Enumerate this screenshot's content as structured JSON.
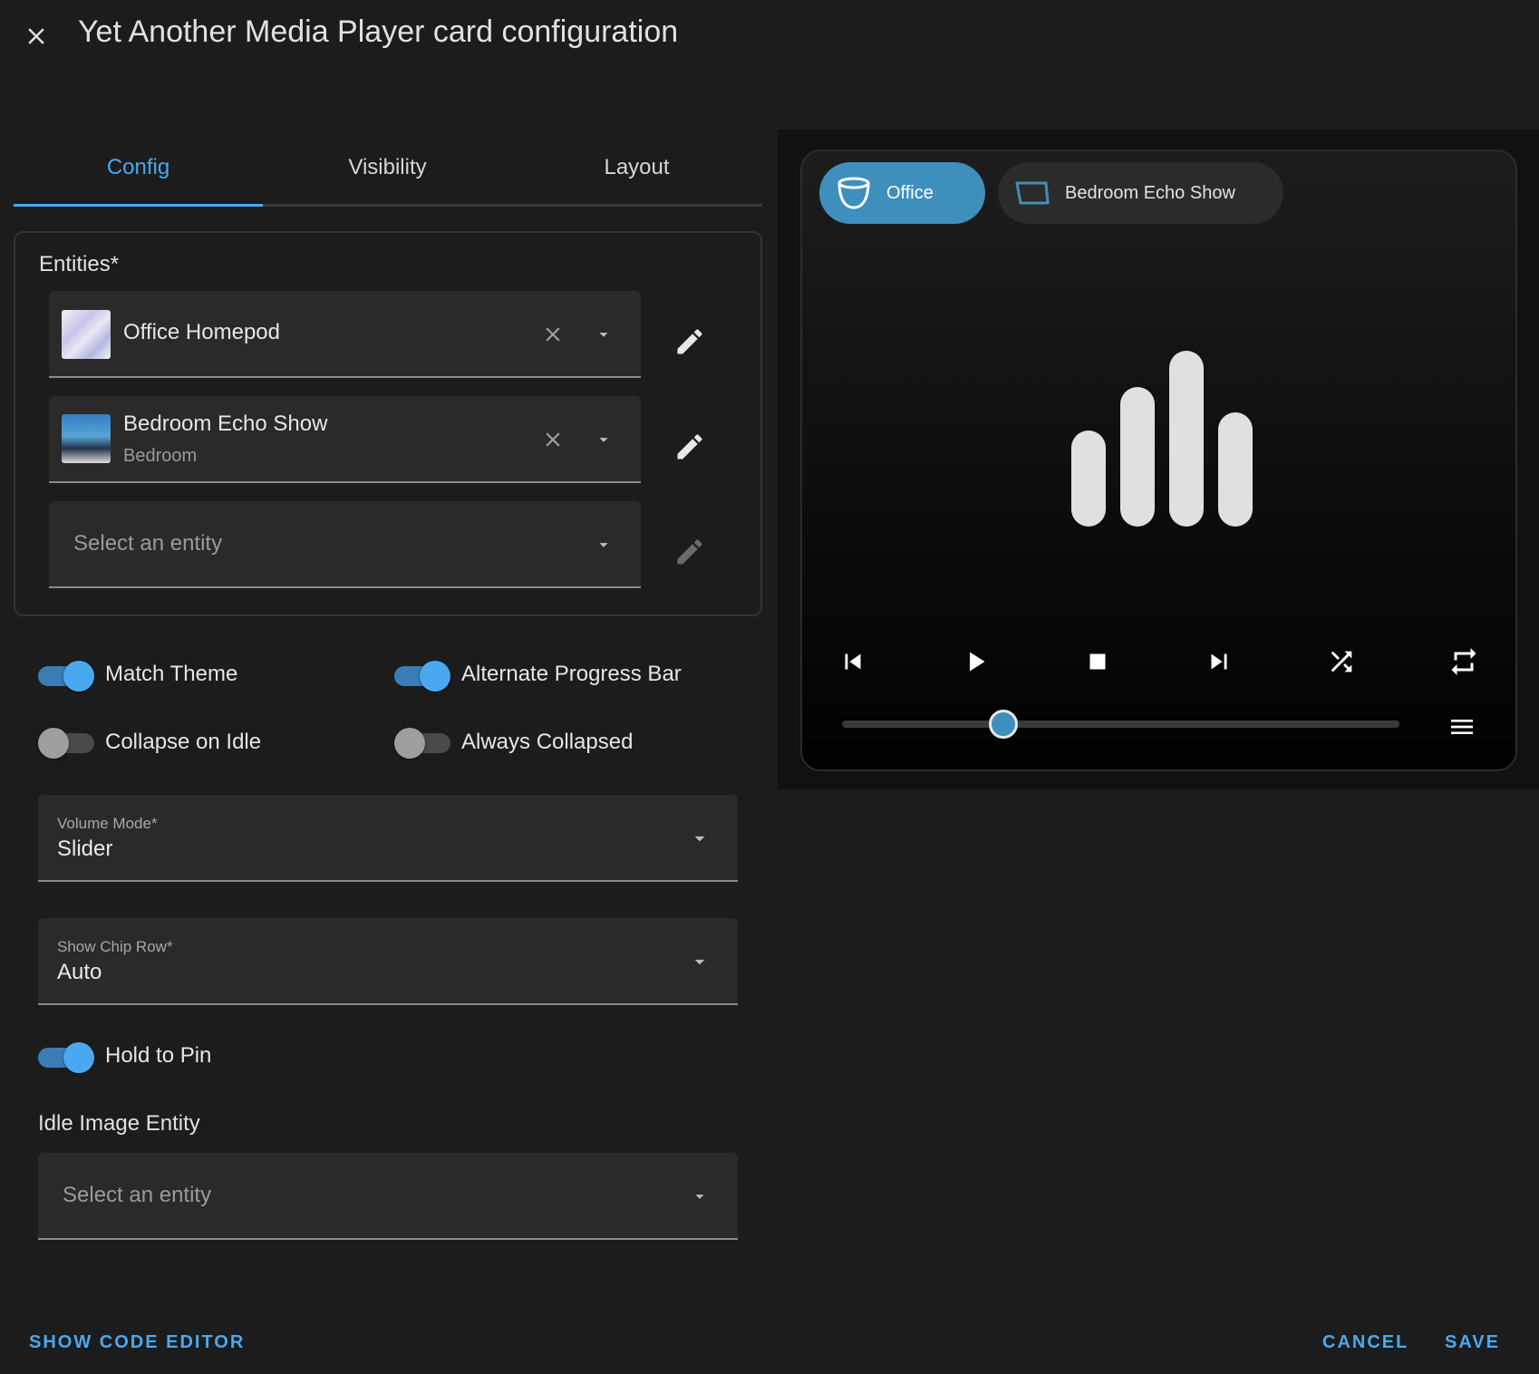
{
  "dialog": {
    "title": "Yet Another Media Player card configuration"
  },
  "tabs": [
    {
      "label": "Config",
      "active": true
    },
    {
      "label": "Visibility",
      "active": false
    },
    {
      "label": "Layout",
      "active": false
    }
  ],
  "entities": {
    "label": "Entities*",
    "items": [
      {
        "name": "Office Homepod",
        "sub": ""
      },
      {
        "name": "Bedroom Echo Show",
        "sub": "Bedroom"
      }
    ],
    "empty_placeholder": "Select an entity"
  },
  "toggles": {
    "match_theme": {
      "label": "Match Theme",
      "on": true
    },
    "alternate_progress_bar": {
      "label": "Alternate Progress Bar",
      "on": true
    },
    "collapse_on_idle": {
      "label": "Collapse on Idle",
      "on": false
    },
    "always_collapsed": {
      "label": "Always Collapsed",
      "on": false
    },
    "hold_to_pin": {
      "label": "Hold to Pin",
      "on": true
    }
  },
  "volume_mode": {
    "label": "Volume Mode*",
    "value": "Slider"
  },
  "show_chip_row": {
    "label": "Show Chip Row*",
    "value": "Auto"
  },
  "idle_image": {
    "label": "Idle Image Entity",
    "placeholder": "Select an entity"
  },
  "footer": {
    "show_code_editor": "SHOW CODE EDITOR",
    "cancel": "CANCEL",
    "save": "SAVE"
  },
  "preview": {
    "chips": [
      {
        "label": "Office",
        "active": true,
        "icon": "homepod-icon"
      },
      {
        "label": "Bedroom Echo Show",
        "active": false,
        "icon": "echo-show-icon"
      }
    ],
    "idle_artwork_icon": "equalizer-bars-icon",
    "controls": [
      "skip-previous-icon",
      "play-icon",
      "stop-icon",
      "skip-next-icon",
      "shuffle-icon",
      "repeat-icon"
    ],
    "menu_icon": "menu-icon",
    "volume_fraction": 0.29
  },
  "colors": {
    "accent": "#4aa8f0",
    "chip_active": "#3f8fbd",
    "background": "#1c1c1c",
    "field": "#2a2a2a"
  }
}
